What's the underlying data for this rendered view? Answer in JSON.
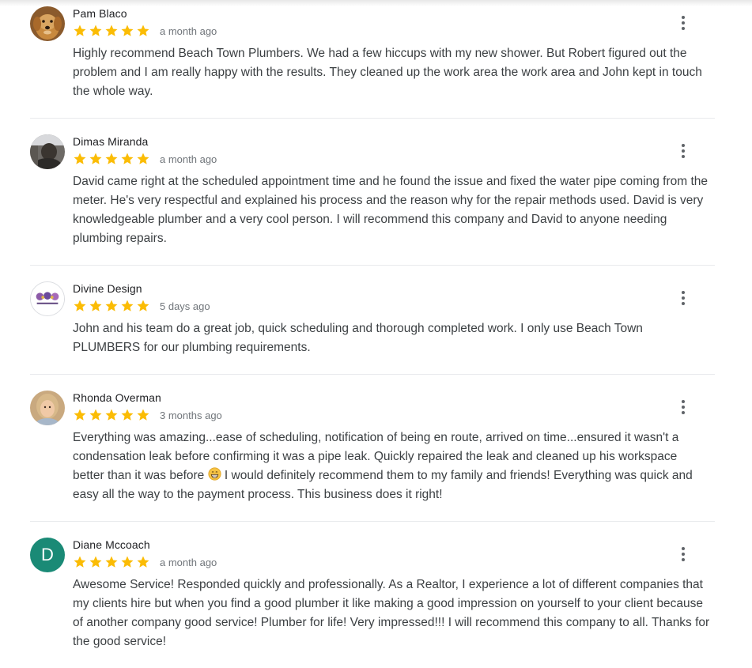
{
  "reviews": [
    {
      "name": "Pam Blaco",
      "rating": 5,
      "date": "a month ago",
      "avatar_icon": "dog-photo",
      "text": "Highly recommend Beach Town Plumbers. We had a few hiccups with my new shower. But Robert figured out the problem and I am really happy with the results. They cleaned up the work area the work area and John kept in touch the whole way."
    },
    {
      "name": "Dimas Miranda",
      "rating": 5,
      "date": "a month ago",
      "avatar_icon": "person-photo",
      "text": "David came right at the scheduled appointment time and he found the issue and fixed the water pipe coming from the meter. He's very respectful and explained his process and the reason why for the repair methods used. David is very knowledgeable plumber and a very cool person. I will recommend this company and David to anyone needing plumbing repairs."
    },
    {
      "name": "Divine Design",
      "rating": 5,
      "date": "5 days ago",
      "avatar_icon": "logo-image",
      "text": "John and his team do a great job, quick scheduling and thorough completed work. I only use Beach Town PLUMBERS for our plumbing requirements."
    },
    {
      "name": "Rhonda Overman",
      "rating": 5,
      "date": "3 months ago",
      "avatar_icon": "person-photo",
      "text_before_emoji": "Everything was amazing...ease of scheduling, notification of being en route, arrived on time...ensured it wasn't a condensation leak before confirming it was a pipe leak. Quickly repaired the leak and cleaned up his workspace better than it was before ",
      "emoji": "grinning-face-emoji",
      "text_after_emoji": " I would definitely recommend them to my family and friends! Everything was quick and easy all the way to the payment process. This business does it right!"
    },
    {
      "name": "Diane Mccoach",
      "rating": 5,
      "date": "a month ago",
      "avatar_letter": "D",
      "avatar_color": "#1a8a76",
      "text": "Awesome Service! Responded quickly and professionally. As a Realtor, I experience a lot of different companies that my clients hire but when you find a good plumber it like making a good impression on yourself to your client because of another company good service! Plumber for life! Very impressed!!! I will recommend this company to all. Thanks for the good service!"
    }
  ],
  "colors": {
    "star": "#fbbc04",
    "name": "#202124",
    "date": "#70757a",
    "text": "#3c4043",
    "divider": "#e8eaed"
  }
}
